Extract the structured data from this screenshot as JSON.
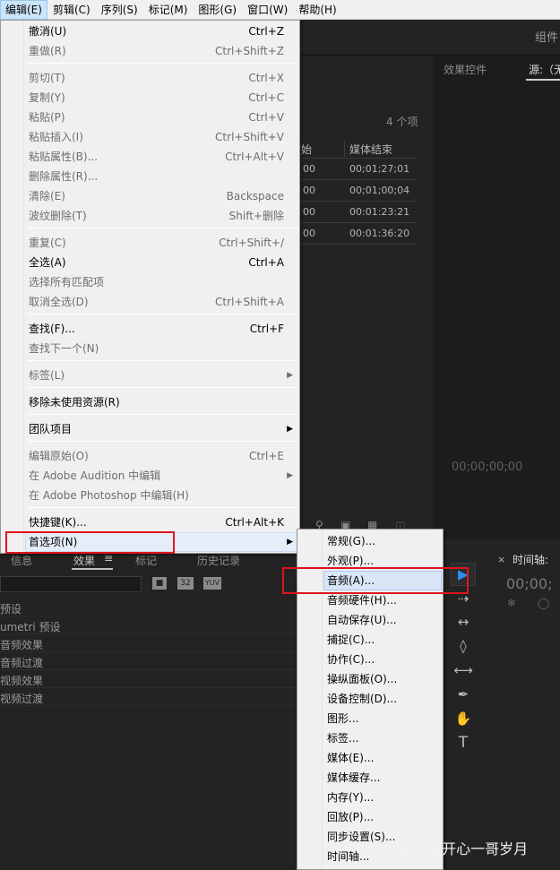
{
  "menubar": [
    {
      "label": "编辑(E)",
      "active": true
    },
    {
      "label": "剪辑(C)"
    },
    {
      "label": "序列(S)"
    },
    {
      "label": "标记(M)"
    },
    {
      "label": "图形(G)"
    },
    {
      "label": "窗口(W)"
    },
    {
      "label": "帮助(H)"
    }
  ],
  "edit_menu": {
    "items": [
      {
        "label": "撤消(U)",
        "shortcut": "Ctrl+Z",
        "enabled": true
      },
      {
        "label": "重做(R)",
        "shortcut": "Ctrl+Shift+Z",
        "enabled": false
      },
      {
        "label": "剪切(T)",
        "shortcut": "Ctrl+X",
        "enabled": false
      },
      {
        "label": "复制(Y)",
        "shortcut": "Ctrl+C",
        "enabled": false
      },
      {
        "label": "粘贴(P)",
        "shortcut": "Ctrl+V",
        "enabled": false
      },
      {
        "label": "粘贴插入(I)",
        "shortcut": "Ctrl+Shift+V",
        "enabled": false
      },
      {
        "label": "粘贴属性(B)...",
        "shortcut": "Ctrl+Alt+V",
        "enabled": false
      },
      {
        "label": "删除属性(R)...",
        "shortcut": "",
        "enabled": false
      },
      {
        "label": "清除(E)",
        "shortcut": "Backspace",
        "enabled": false
      },
      {
        "label": "波纹删除(T)",
        "shortcut": "Shift+删除",
        "enabled": false
      },
      {
        "label": "重复(C)",
        "shortcut": "Ctrl+Shift+/",
        "enabled": false
      },
      {
        "label": "全选(A)",
        "shortcut": "Ctrl+A",
        "enabled": true
      },
      {
        "label": "选择所有匹配项",
        "shortcut": "",
        "enabled": false
      },
      {
        "label": "取消全选(D)",
        "shortcut": "Ctrl+Shift+A",
        "enabled": false
      },
      {
        "label": "查找(F)...",
        "shortcut": "Ctrl+F",
        "enabled": true
      },
      {
        "label": "查找下一个(N)",
        "shortcut": "",
        "enabled": false
      },
      {
        "label": "标签(L)",
        "shortcut": "",
        "enabled": false,
        "submenu": true
      },
      {
        "label": "移除未使用资源(R)",
        "shortcut": "",
        "enabled": true
      },
      {
        "label": "团队项目",
        "shortcut": "",
        "enabled": true,
        "submenu": true
      },
      {
        "label": "编辑原始(O)",
        "shortcut": "Ctrl+E",
        "enabled": false
      },
      {
        "label": "在 Adobe Audition 中编辑",
        "shortcut": "",
        "enabled": false,
        "submenu": true
      },
      {
        "label": "在 Adobe Photoshop 中编辑(H)",
        "shortcut": "",
        "enabled": false
      },
      {
        "label": "快捷键(K)...",
        "shortcut": "Ctrl+Alt+K",
        "enabled": true
      },
      {
        "label": "首选项(N)",
        "shortcut": "",
        "enabled": true,
        "submenu": true,
        "highlighted": true
      }
    ]
  },
  "preferences_submenu": {
    "items": [
      {
        "label": "常规(G)..."
      },
      {
        "label": "外观(P)..."
      },
      {
        "label": "音频(A)...",
        "highlighted": true
      },
      {
        "label": "音频硬件(H)..."
      },
      {
        "label": "自动保存(U)..."
      },
      {
        "label": "捕捉(C)..."
      },
      {
        "label": "协作(C)..."
      },
      {
        "label": "操纵面板(O)..."
      },
      {
        "label": "设备控制(D)..."
      },
      {
        "label": "图形..."
      },
      {
        "label": "标签..."
      },
      {
        "label": "媒体(E)..."
      },
      {
        "label": "媒体缓存..."
      },
      {
        "label": "内存(Y)..."
      },
      {
        "label": "回放(P)..."
      },
      {
        "label": "同步设置(S)..."
      },
      {
        "label": "时间轴..."
      }
    ]
  },
  "background": {
    "top_right_tab": "组件",
    "effect_controls_tab": "效果控件",
    "source_tab": "源:（无",
    "item_count": "4 个项",
    "table_headers": [
      "始",
      "媒体结束"
    ],
    "table_rows": [
      [
        "00",
        "00;01;27;01"
      ],
      [
        "00",
        "00;01;00;04"
      ],
      [
        "00",
        "00:01:23:21"
      ],
      [
        "00",
        "00:01:36:20"
      ]
    ],
    "source_timecode": "00;00;00;00",
    "timeline_tab": "时间轴:",
    "timeline_timecode": "00;00;",
    "bottom_tabs": [
      "信息",
      "效果",
      "标记",
      "历史记录"
    ],
    "effect_badges": [
      "32",
      "YUV"
    ],
    "effects_list": [
      "预设",
      "umetri 预设",
      "音频效果",
      "音频过渡",
      "视频效果",
      "视频过渡"
    ]
  },
  "watermark": "知乎 @开心一哥岁月"
}
